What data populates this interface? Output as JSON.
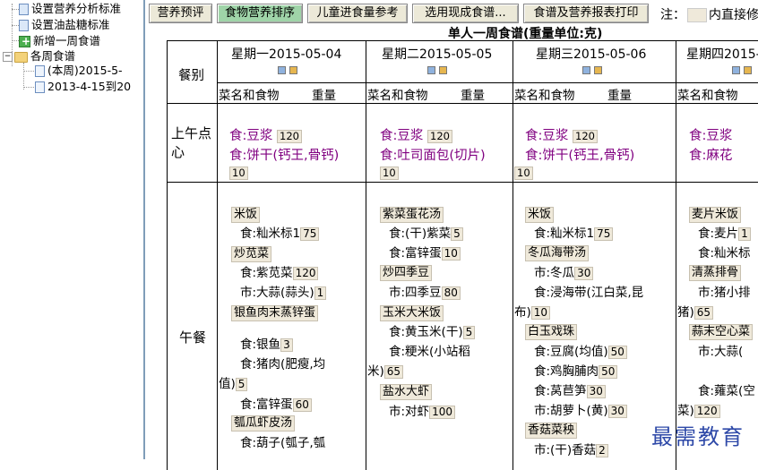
{
  "tree": {
    "items": [
      {
        "label": "设置营养分析标准"
      },
      {
        "label": "设置油盐糖标准"
      },
      {
        "label": "新增一周食谱"
      },
      {
        "label": "各周食谱"
      },
      {
        "label": "(本周)2015-5-"
      },
      {
        "label": "2013-4-15到20"
      }
    ]
  },
  "toolbar": {
    "buttons": [
      "营养预评",
      "食物营养排序",
      "儿童进食量参考",
      "选用现成食谱...",
      "食谱及营养报表打印"
    ],
    "note": "注：",
    "note_tail": "内直接修"
  },
  "title": "单人一周食谱(重量单位:克)",
  "grid": {
    "meal_header": "餐别",
    "days": [
      "星期一2015-05-04",
      "星期二2015-05-05",
      "星期三2015-05-06",
      "星期四2015-0"
    ],
    "col_header_name": "菜名和食物",
    "col_header_weight": "重量",
    "meals": [
      "上午点心",
      "午餐"
    ],
    "snack": [
      {
        "f1": "食:豆浆",
        "q1": "120",
        "f2": "食:饼干(钙王,骨钙)",
        "q2": "10"
      },
      {
        "f1": "食:豆浆",
        "q1": "120",
        "f2": "食:吐司面包(切片)",
        "q2": "10"
      },
      {
        "f1": "食:豆浆",
        "q1": "120",
        "f2": "食:饼干(钙王,骨钙)",
        "q2": "10"
      },
      {
        "f1": "食:豆浆",
        "q1": "",
        "f2": "食:麻花",
        "q2": ""
      }
    ],
    "lunch_mon": {
      "d1": "米饭",
      "i1": "食:籼米标1",
      "q1": "75",
      "d2": "炒苋菜",
      "i2": "食:紫苋菜",
      "q2": "120",
      "i3": "市:大蒜(蒜头)",
      "q3": "1",
      "d3": "银鱼肉末蒸锌蛋",
      "i4": "食:银鱼",
      "q4": "3",
      "i5": "食:猪肉(肥瘦,均",
      "i5b": "值)",
      "q5": "5",
      "i6": "食:富锌蛋",
      "q6": "60",
      "d4": "瓠瓜虾皮汤",
      "i7": "食:葫子(瓠子,瓠"
    },
    "lunch_tue": {
      "d1": "紫菜蛋花汤",
      "i1": "食:(干)紫菜",
      "q1": "5",
      "i2": "食:富锌蛋",
      "q2": "10",
      "d2": "炒四季豆",
      "i3": "市:四季豆",
      "q3": "80",
      "d3": "玉米大米饭",
      "i4": "食:黄玉米(干)",
      "q4": "5",
      "i5": "食:粳米(小站稻",
      "i5b": "米)",
      "q5": "65",
      "d4": "盐水大虾",
      "i6": "市:对虾",
      "q6": "100"
    },
    "lunch_wed": {
      "d1": "米饭",
      "i1": "食:籼米标1",
      "q1": "75",
      "d2": "冬瓜海带汤",
      "i2": "市:冬瓜",
      "q2": "30",
      "i3": "食:浸海带(江白菜,昆",
      "i3b": "布)",
      "q3": "10",
      "d3": "白玉戏珠",
      "i4": "食:豆腐(均值)",
      "q4": "50",
      "i5": "食:鸡胸脯肉",
      "q5": "50",
      "i6": "食:莴苣笋",
      "q6": "30",
      "i7": "市:胡萝卜(黄)",
      "q7": "30",
      "d4": "香菇菜秧",
      "i8": "市:(干)香菇",
      "q8": "2"
    },
    "lunch_thu": {
      "d1": "麦片米饭",
      "i1": "食:麦片",
      "q1": "1",
      "i2": "食:籼米标",
      "d2": "清蒸排骨",
      "i3": "市:猪小排",
      "i3b": "猪)",
      "q3": "65",
      "d3": "蒜末空心菜",
      "i4": "市:大蒜(",
      "i5": "食:蕹菜(空",
      "i5b": "菜)",
      "q5": "120"
    }
  },
  "watermark": "最需教育"
}
